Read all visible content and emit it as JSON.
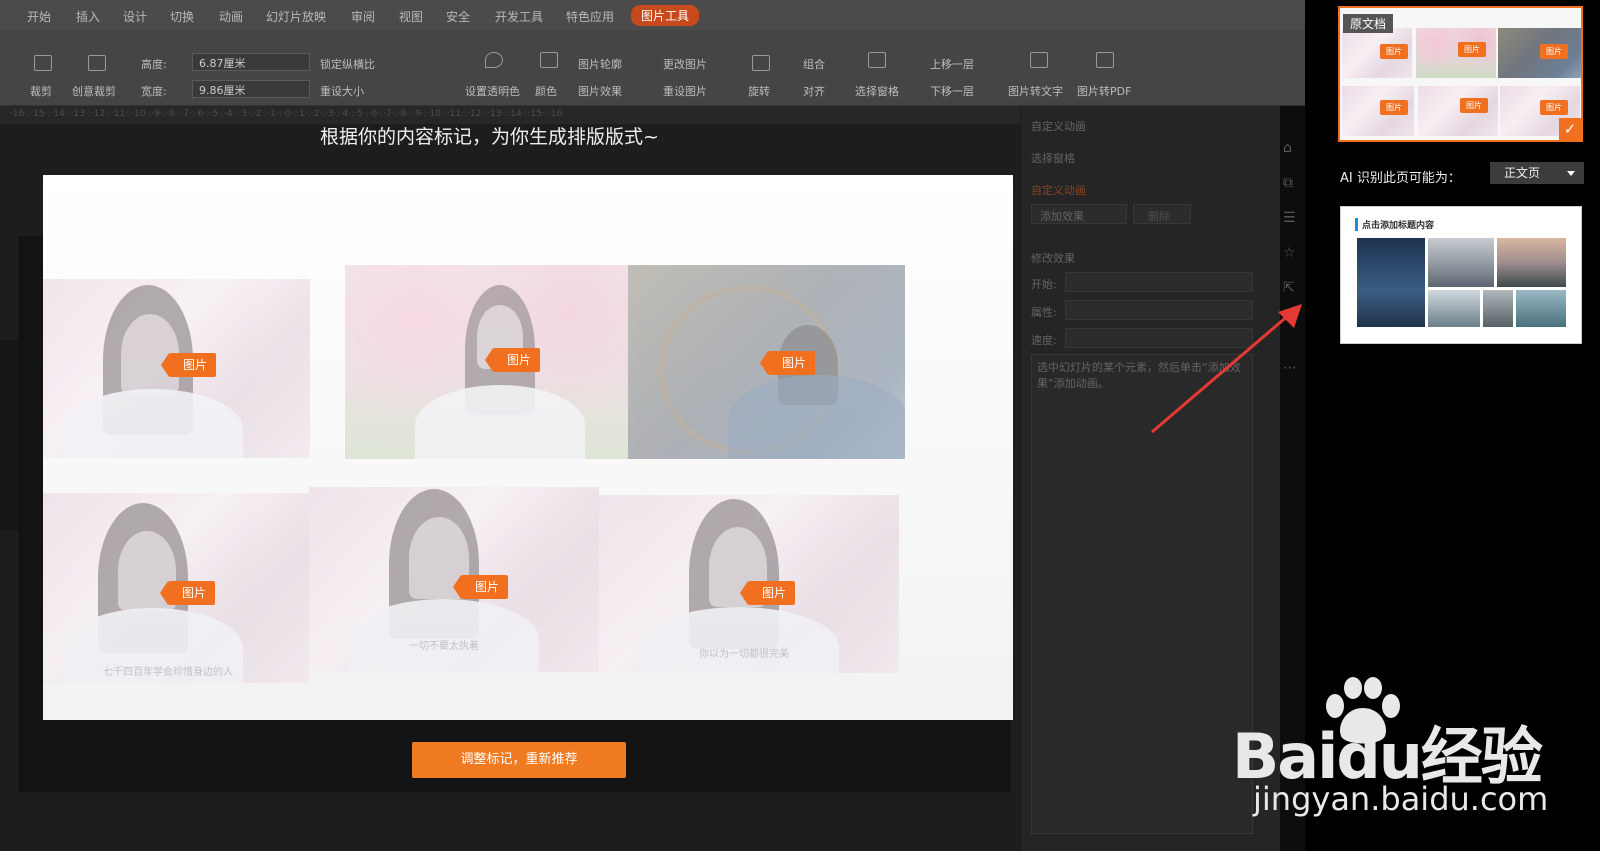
{
  "ribbon": {
    "tabs": [
      "开始",
      "插入",
      "设计",
      "切换",
      "动画",
      "幻灯片放映",
      "审阅",
      "视图",
      "安全",
      "开发工具",
      "特色应用",
      "图片工具"
    ],
    "tools": {
      "crop": "裁剪",
      "creative_crop": "创意裁剪",
      "height_label": "高度:",
      "height_value": "6.87厘米",
      "width_label": "宽度:",
      "width_value": "9.86厘米",
      "lock_ratio": "锁定纵横比",
      "reset_size": "重设大小",
      "set_transparent": "设置透明色",
      "color": "颜色",
      "picture_outline": "图片轮廓",
      "picture_effect": "图片效果",
      "change_picture": "更改图片",
      "reset_picture": "重设图片",
      "rotate": "旋转",
      "group": "组合",
      "align": "对齐",
      "selection_pane": "选择窗格",
      "bring_forward": "上移一层",
      "send_backward": "下移一层",
      "pic_to_text": "图片转文字",
      "pic_to_pdf": "图片转PDF"
    },
    "ruler": "·16·:·15·:·14·:·13·:·12·:·11·:·10·:·9·:·8·:·7·:·6·:·5·:·4·:·3·:·2·:·1·:·0·:·1·:·2·:·3·:·4·:·5·:·6·:·7·:·8·:·9·:·10·:·11·:·12·:·13·:·14·:·15·:·16·"
  },
  "anim_panel": {
    "header": "自定义动画",
    "selection_pane": "选择窗格",
    "section_title": "自定义动画",
    "add_effect": "添加效果",
    "delete": "删除",
    "modify_effect": "修改效果",
    "start_label": "开始:",
    "property_label": "属性:",
    "speed_label": "速度:",
    "hint": "选中幻灯片的某个元素，然后单击“添加效果”添加动画。"
  },
  "dialog": {
    "heading": "根据你的内容标记，为你生成排版版式~",
    "tag_label": "图片",
    "captions": [
      "七千四百年学会珍惜身边的人",
      "一切不要太执着",
      "你以为一切都很完美"
    ],
    "cta": "调整标记，重新推荐"
  },
  "right_panel": {
    "card1_label": "原文档",
    "mini_tag": "图片",
    "ai_label": "AI 识别此页可能为：",
    "ai_select_value": "正文页",
    "card2_title": "点击添加标题内容"
  },
  "watermark": {
    "brand": "Baidu经验",
    "url": "jingyan.baidu.com"
  },
  "colors": {
    "accent": "#f07020",
    "active_tab": "#c64a1c"
  }
}
